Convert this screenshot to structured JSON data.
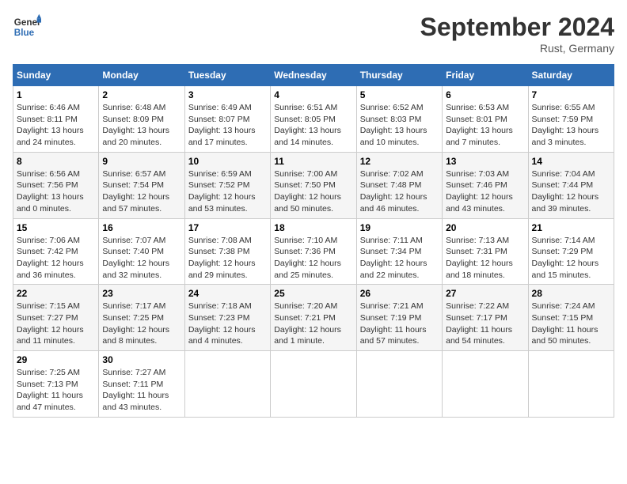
{
  "header": {
    "logo_line1": "General",
    "logo_line2": "Blue",
    "month_year": "September 2024",
    "location": "Rust, Germany"
  },
  "weekdays": [
    "Sunday",
    "Monday",
    "Tuesday",
    "Wednesday",
    "Thursday",
    "Friday",
    "Saturday"
  ],
  "weeks": [
    [
      {
        "day": "1",
        "sunrise": "Sunrise: 6:46 AM",
        "sunset": "Sunset: 8:11 PM",
        "daylight": "Daylight: 13 hours and 24 minutes."
      },
      {
        "day": "2",
        "sunrise": "Sunrise: 6:48 AM",
        "sunset": "Sunset: 8:09 PM",
        "daylight": "Daylight: 13 hours and 20 minutes."
      },
      {
        "day": "3",
        "sunrise": "Sunrise: 6:49 AM",
        "sunset": "Sunset: 8:07 PM",
        "daylight": "Daylight: 13 hours and 17 minutes."
      },
      {
        "day": "4",
        "sunrise": "Sunrise: 6:51 AM",
        "sunset": "Sunset: 8:05 PM",
        "daylight": "Daylight: 13 hours and 14 minutes."
      },
      {
        "day": "5",
        "sunrise": "Sunrise: 6:52 AM",
        "sunset": "Sunset: 8:03 PM",
        "daylight": "Daylight: 13 hours and 10 minutes."
      },
      {
        "day": "6",
        "sunrise": "Sunrise: 6:53 AM",
        "sunset": "Sunset: 8:01 PM",
        "daylight": "Daylight: 13 hours and 7 minutes."
      },
      {
        "day": "7",
        "sunrise": "Sunrise: 6:55 AM",
        "sunset": "Sunset: 7:59 PM",
        "daylight": "Daylight: 13 hours and 3 minutes."
      }
    ],
    [
      {
        "day": "8",
        "sunrise": "Sunrise: 6:56 AM",
        "sunset": "Sunset: 7:56 PM",
        "daylight": "Daylight: 13 hours and 0 minutes."
      },
      {
        "day": "9",
        "sunrise": "Sunrise: 6:57 AM",
        "sunset": "Sunset: 7:54 PM",
        "daylight": "Daylight: 12 hours and 57 minutes."
      },
      {
        "day": "10",
        "sunrise": "Sunrise: 6:59 AM",
        "sunset": "Sunset: 7:52 PM",
        "daylight": "Daylight: 12 hours and 53 minutes."
      },
      {
        "day": "11",
        "sunrise": "Sunrise: 7:00 AM",
        "sunset": "Sunset: 7:50 PM",
        "daylight": "Daylight: 12 hours and 50 minutes."
      },
      {
        "day": "12",
        "sunrise": "Sunrise: 7:02 AM",
        "sunset": "Sunset: 7:48 PM",
        "daylight": "Daylight: 12 hours and 46 minutes."
      },
      {
        "day": "13",
        "sunrise": "Sunrise: 7:03 AM",
        "sunset": "Sunset: 7:46 PM",
        "daylight": "Daylight: 12 hours and 43 minutes."
      },
      {
        "day": "14",
        "sunrise": "Sunrise: 7:04 AM",
        "sunset": "Sunset: 7:44 PM",
        "daylight": "Daylight: 12 hours and 39 minutes."
      }
    ],
    [
      {
        "day": "15",
        "sunrise": "Sunrise: 7:06 AM",
        "sunset": "Sunset: 7:42 PM",
        "daylight": "Daylight: 12 hours and 36 minutes."
      },
      {
        "day": "16",
        "sunrise": "Sunrise: 7:07 AM",
        "sunset": "Sunset: 7:40 PM",
        "daylight": "Daylight: 12 hours and 32 minutes."
      },
      {
        "day": "17",
        "sunrise": "Sunrise: 7:08 AM",
        "sunset": "Sunset: 7:38 PM",
        "daylight": "Daylight: 12 hours and 29 minutes."
      },
      {
        "day": "18",
        "sunrise": "Sunrise: 7:10 AM",
        "sunset": "Sunset: 7:36 PM",
        "daylight": "Daylight: 12 hours and 25 minutes."
      },
      {
        "day": "19",
        "sunrise": "Sunrise: 7:11 AM",
        "sunset": "Sunset: 7:34 PM",
        "daylight": "Daylight: 12 hours and 22 minutes."
      },
      {
        "day": "20",
        "sunrise": "Sunrise: 7:13 AM",
        "sunset": "Sunset: 7:31 PM",
        "daylight": "Daylight: 12 hours and 18 minutes."
      },
      {
        "day": "21",
        "sunrise": "Sunrise: 7:14 AM",
        "sunset": "Sunset: 7:29 PM",
        "daylight": "Daylight: 12 hours and 15 minutes."
      }
    ],
    [
      {
        "day": "22",
        "sunrise": "Sunrise: 7:15 AM",
        "sunset": "Sunset: 7:27 PM",
        "daylight": "Daylight: 12 hours and 11 minutes."
      },
      {
        "day": "23",
        "sunrise": "Sunrise: 7:17 AM",
        "sunset": "Sunset: 7:25 PM",
        "daylight": "Daylight: 12 hours and 8 minutes."
      },
      {
        "day": "24",
        "sunrise": "Sunrise: 7:18 AM",
        "sunset": "Sunset: 7:23 PM",
        "daylight": "Daylight: 12 hours and 4 minutes."
      },
      {
        "day": "25",
        "sunrise": "Sunrise: 7:20 AM",
        "sunset": "Sunset: 7:21 PM",
        "daylight": "Daylight: 12 hours and 1 minute."
      },
      {
        "day": "26",
        "sunrise": "Sunrise: 7:21 AM",
        "sunset": "Sunset: 7:19 PM",
        "daylight": "Daylight: 11 hours and 57 minutes."
      },
      {
        "day": "27",
        "sunrise": "Sunrise: 7:22 AM",
        "sunset": "Sunset: 7:17 PM",
        "daylight": "Daylight: 11 hours and 54 minutes."
      },
      {
        "day": "28",
        "sunrise": "Sunrise: 7:24 AM",
        "sunset": "Sunset: 7:15 PM",
        "daylight": "Daylight: 11 hours and 50 minutes."
      }
    ],
    [
      {
        "day": "29",
        "sunrise": "Sunrise: 7:25 AM",
        "sunset": "Sunset: 7:13 PM",
        "daylight": "Daylight: 11 hours and 47 minutes."
      },
      {
        "day": "30",
        "sunrise": "Sunrise: 7:27 AM",
        "sunset": "Sunset: 7:11 PM",
        "daylight": "Daylight: 11 hours and 43 minutes."
      },
      null,
      null,
      null,
      null,
      null
    ]
  ]
}
